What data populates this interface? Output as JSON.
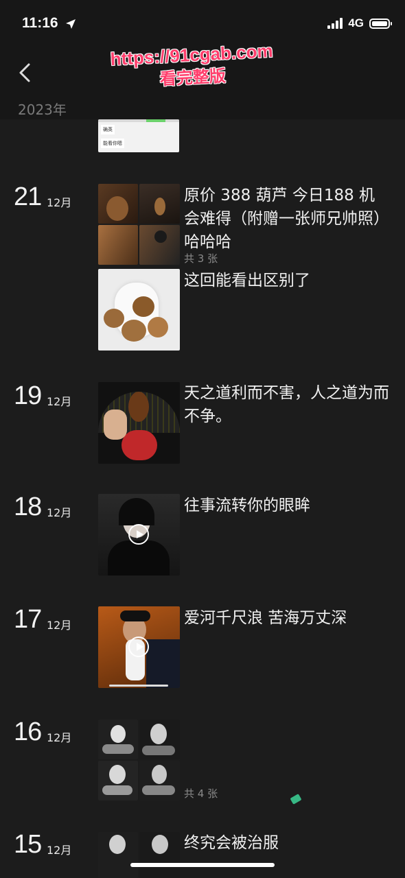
{
  "status_bar": {
    "time": "11:16",
    "network": "4G"
  },
  "nav": {
    "year": "2023年",
    "watermark_url": "https://91cgab.com",
    "watermark_sub": "看完整版"
  },
  "top_preview": {
    "line1": "确英",
    "line2": "能看你嗯"
  },
  "posts": [
    {
      "day": "21",
      "month": "12月",
      "text": "原价 388 葫芦  今日188 机会难得（附赠一张师兄帅照）哈哈哈",
      "count": "共 3 张"
    },
    {
      "text": "这回能看出区别了"
    },
    {
      "day": "19",
      "month": "12月",
      "text": "天之道利而不害，人之道为而不争。"
    },
    {
      "day": "18",
      "month": "12月",
      "text": "往事流转你的眼眸"
    },
    {
      "day": "17",
      "month": "12月",
      "text": "爱河千尺浪 苦海万丈深"
    },
    {
      "day": "16",
      "month": "12月",
      "text": "",
      "count": "共 4 张"
    },
    {
      "day": "15",
      "month": "12月",
      "text": "终究会被治服"
    }
  ]
}
